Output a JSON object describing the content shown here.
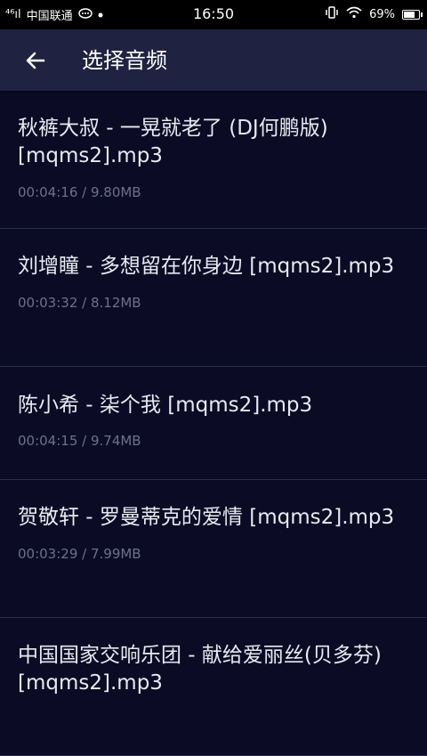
{
  "status_bar": {
    "signal_label": "⁴⁶ıl",
    "carrier": "中国联通",
    "time": "16:50",
    "battery_percent": "69%"
  },
  "header": {
    "title": "选择音频"
  },
  "audio_list": [
    {
      "title": "秋裤大叔 - 一晃就老了 (DJ何鹏版) [mqms2].mp3",
      "meta": "00:04:16 / 9.80MB"
    },
    {
      "title": "刘增瞳 - 多想留在你身边 [mqms2].mp3",
      "meta": "00:03:32 / 8.12MB"
    },
    {
      "title": "陈小希 - 柒个我 [mqms2].mp3",
      "meta": "00:04:15 / 9.74MB"
    },
    {
      "title": "贺敬轩 - 罗曼蒂克的爱情 [mqms2].mp3",
      "meta": "00:03:29 / 7.99MB"
    },
    {
      "title": "中国国家交响乐团 - 献给爱丽丝(贝多芬) [mqms2].mp3",
      "meta": ""
    }
  ]
}
